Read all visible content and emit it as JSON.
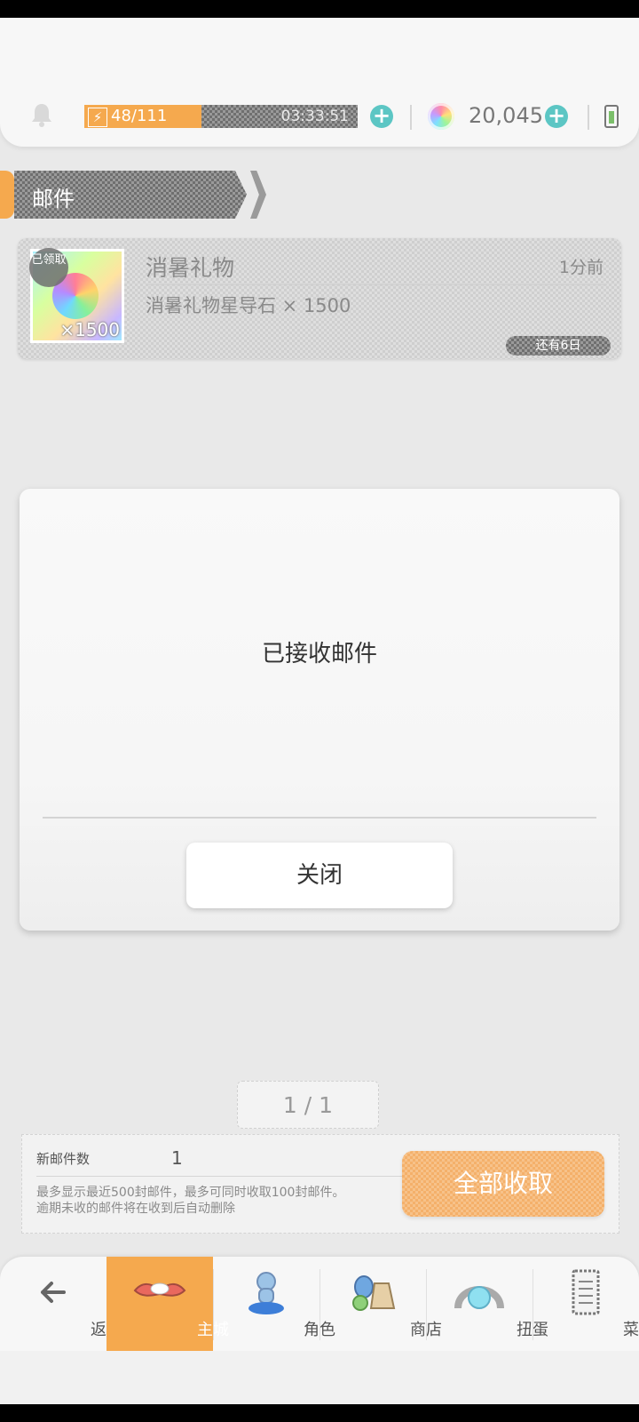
{
  "topbar": {
    "energy": "48/111",
    "energy_fill": 0.43,
    "timer": "03:33:51",
    "gems": "20,045"
  },
  "section": {
    "title": "邮件"
  },
  "mail": {
    "title": "消暑礼物",
    "time": "1分前",
    "description": "消暑礼物星导石 × 1500",
    "thumb_claimed": "已领取",
    "thumb_qty": "×1500",
    "expires": "还有6日"
  },
  "dialog": {
    "message": "已接收邮件",
    "close_label": "关闭"
  },
  "pager": {
    "text": "1 / 1"
  },
  "info": {
    "new_mail_label": "新邮件数",
    "new_mail_count": "1",
    "note_line1": "最多显示最近500封邮件，最多可同时收取100封邮件。",
    "note_line2": "逾期未收的邮件将在收到后自动删除",
    "collect_all_label": "全部收取"
  },
  "nav": {
    "items": [
      {
        "label": "返回",
        "icon": "back-arrow-icon"
      },
      {
        "label": "主城",
        "icon": "main-city-icon"
      },
      {
        "label": "角色",
        "icon": "character-icon"
      },
      {
        "label": "商店",
        "icon": "shop-icon"
      },
      {
        "label": "扭蛋",
        "icon": "gacha-icon"
      },
      {
        "label": "菜单",
        "icon": "menu-icon"
      }
    ]
  },
  "colors": {
    "accent_orange": "#f5a94e",
    "plus_teal": "#5cc6c4"
  }
}
